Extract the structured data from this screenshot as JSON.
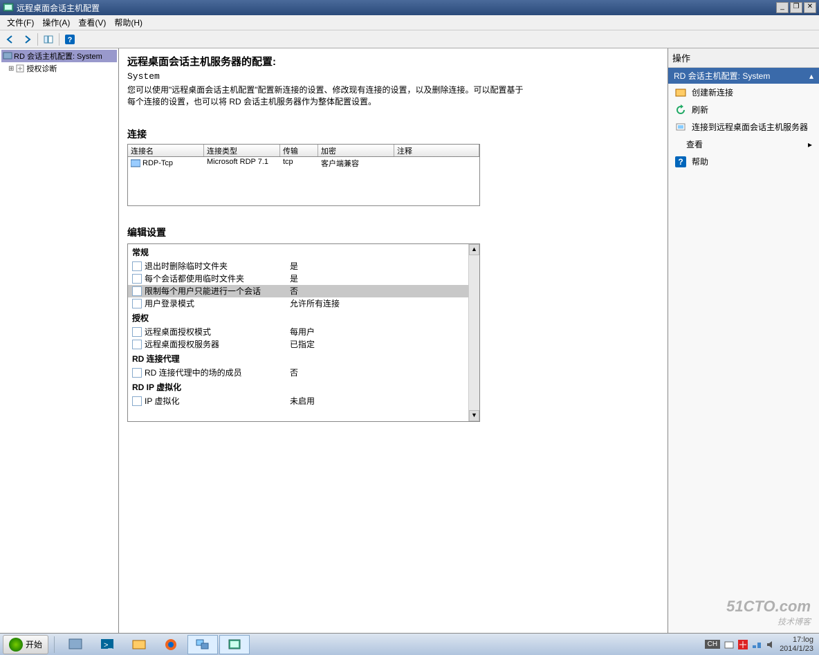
{
  "titlebar": {
    "title": "远程桌面会话主机配置"
  },
  "menu": {
    "file": "文件(F)",
    "action": "操作(A)",
    "view": "查看(V)",
    "help": "帮助(H)"
  },
  "tree": {
    "root": "RD 会话主机配置: System",
    "child": "授权诊断"
  },
  "center": {
    "title": "远程桌面会话主机服务器的配置:",
    "system": "System",
    "desc": "您可以使用\"远程桌面会话主机配置\"配置新连接的设置、修改现有连接的设置，以及删除连接。可以配置基于每个连接的设置，也可以将 RD 会话主机服务器作为整体配置设置。",
    "conn_label": "连接",
    "conn_headers": {
      "name": "连接名",
      "type": "连接类型",
      "trans": "传输",
      "enc": "加密",
      "comm": "注释"
    },
    "conn_row": {
      "name": "RDP-Tcp",
      "type": "Microsoft RDP 7.1",
      "trans": "tcp",
      "enc": "客户端兼容",
      "comm": ""
    },
    "edit_label": "编辑设置",
    "groups": {
      "general": "常规",
      "license": "授权",
      "broker": "RD 连接代理",
      "ipv": "RD IP 虚拟化"
    },
    "rows": {
      "g1": {
        "label": "退出时删除临时文件夹",
        "val": "是"
      },
      "g2": {
        "label": "每个会话都使用临时文件夹",
        "val": "是"
      },
      "g3": {
        "label": "限制每个用户只能进行一个会话",
        "val": "否"
      },
      "g4": {
        "label": "用户登录模式",
        "val": "允许所有连接"
      },
      "l1": {
        "label": "远程桌面授权模式",
        "val": "每用户"
      },
      "l2": {
        "label": "远程桌面授权服务器",
        "val": "已指定"
      },
      "b1": {
        "label": "RD 连接代理中的场的成员",
        "val": "否"
      },
      "i1": {
        "label": "IP 虚拟化",
        "val": "未启用"
      }
    }
  },
  "right": {
    "header": "操作",
    "section": "RD 会话主机配置: System",
    "items": {
      "new": "创建新连接",
      "refresh": "刷新",
      "connect": "连接到远程桌面会话主机服务器",
      "view": "查看",
      "help": "帮助"
    }
  },
  "taskbar": {
    "start": "开始",
    "ime": "CH",
    "time": "17:",
    "timesuffix": "log",
    "date": "2014/1/23"
  },
  "watermark": {
    "main": "51CTO.com",
    "sub": "技术博客"
  }
}
